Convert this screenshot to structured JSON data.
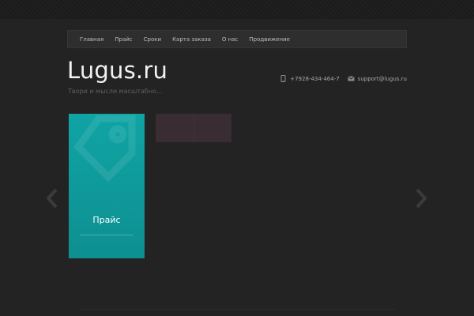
{
  "nav": {
    "items": [
      {
        "label": "Главная"
      },
      {
        "label": "Прайс"
      },
      {
        "label": "Сроки"
      },
      {
        "label": "Карта заказа"
      },
      {
        "label": "О нас"
      },
      {
        "label": "Продвижение"
      }
    ]
  },
  "header": {
    "logo": "Lugus.ru",
    "tagline": "Твори и мысли масштабно..."
  },
  "contacts": {
    "phone": "+7928-434-464-7",
    "phone_icon": "phone-icon",
    "email": "support@lugus.ru",
    "email_icon": "envelope-icon"
  },
  "slider": {
    "prev_icon": "chevron-left-icon",
    "next_icon": "chevron-right-icon",
    "card_title": "Прайс",
    "card_icon": "tag-icon"
  },
  "colors": {
    "background": "#232323",
    "nav_bar": "#2e2e2e",
    "accent_teal": "#10a4a4",
    "tile_plum": "#3a2c33"
  }
}
